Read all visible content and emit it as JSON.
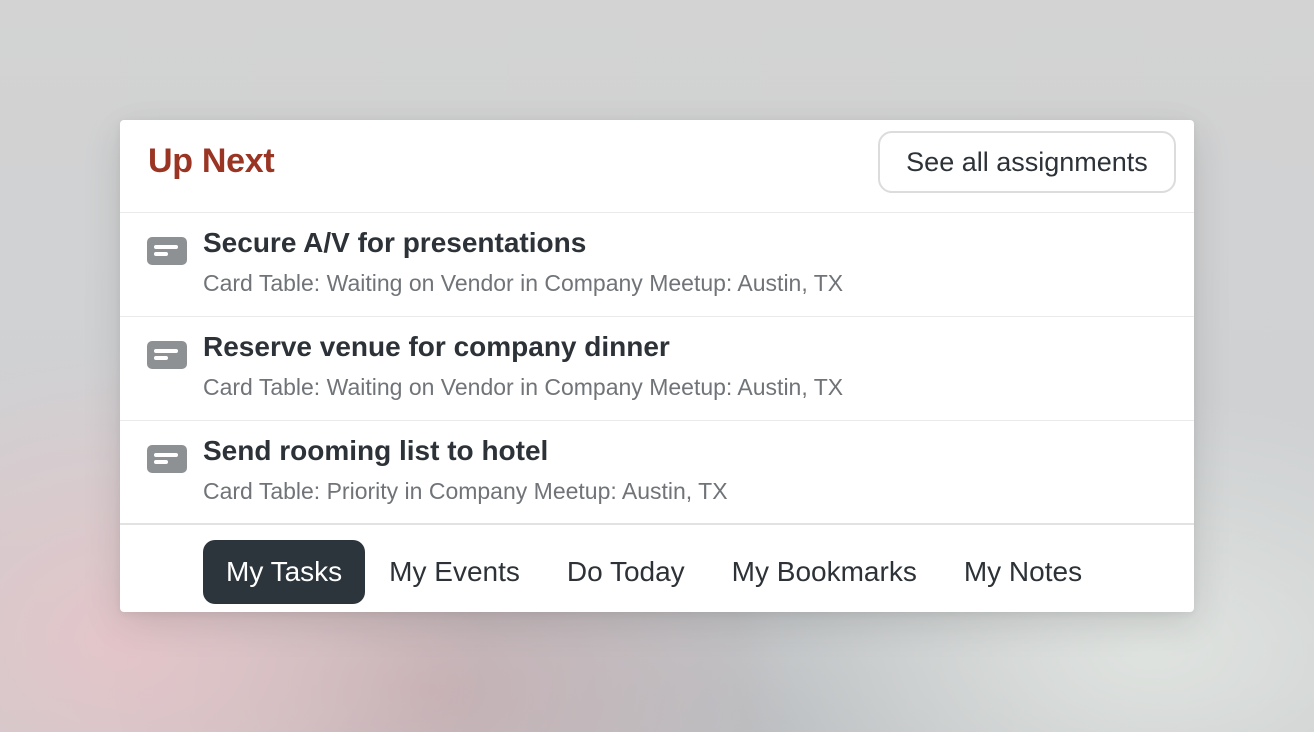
{
  "panel": {
    "title": "Up Next",
    "see_all_label": "See all assignments"
  },
  "tasks": [
    {
      "icon": "card-icon",
      "title": "Secure A/V for presentations",
      "subtitle": "Card Table: Waiting on Vendor in Company Meetup: Austin, TX"
    },
    {
      "icon": "card-icon",
      "title": "Reserve venue for company dinner",
      "subtitle": "Card Table: Waiting on Vendor in Company Meetup: Austin, TX"
    },
    {
      "icon": "card-icon",
      "title": "Send rooming list to hotel",
      "subtitle": "Card Table: Priority in Company Meetup: Austin, TX"
    }
  ],
  "tabs": [
    {
      "label": "My Tasks",
      "active": true
    },
    {
      "label": "My Events",
      "active": false
    },
    {
      "label": "Do Today",
      "active": false
    },
    {
      "label": "My Bookmarks",
      "active": false
    },
    {
      "label": "My Notes",
      "active": false
    }
  ],
  "colors": {
    "title_accent": "#9a3524",
    "active_tab_bg": "#2c343c",
    "text_primary": "#2c3237",
    "text_secondary": "#707478",
    "icon_gray": "#8e9193"
  }
}
